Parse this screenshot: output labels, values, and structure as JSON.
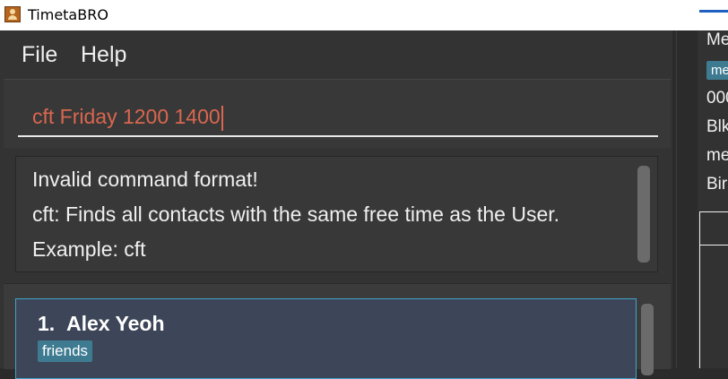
{
  "window": {
    "title": "TimetaBRO"
  },
  "menu": {
    "file": "File",
    "help": "Help"
  },
  "command": {
    "value": "cft Friday 1200 1400"
  },
  "result": {
    "lines": [
      "Invalid command format!",
      "cft: Finds all contacts with the same free time as the User.",
      "Example: cft"
    ]
  },
  "persons": [
    {
      "index": "1.",
      "name": "Alex Yeoh",
      "tags": [
        "friends"
      ]
    }
  ],
  "detail": {
    "lines": [
      "Me",
      "000",
      "Blk",
      "me",
      "Bir"
    ],
    "tag": "me"
  },
  "colors": {
    "background": "#2b2b2b",
    "command_text": "#d9674f",
    "tag": "#3e7b91",
    "card_selected": "#3d4658",
    "card_border": "#3fa3c9"
  }
}
